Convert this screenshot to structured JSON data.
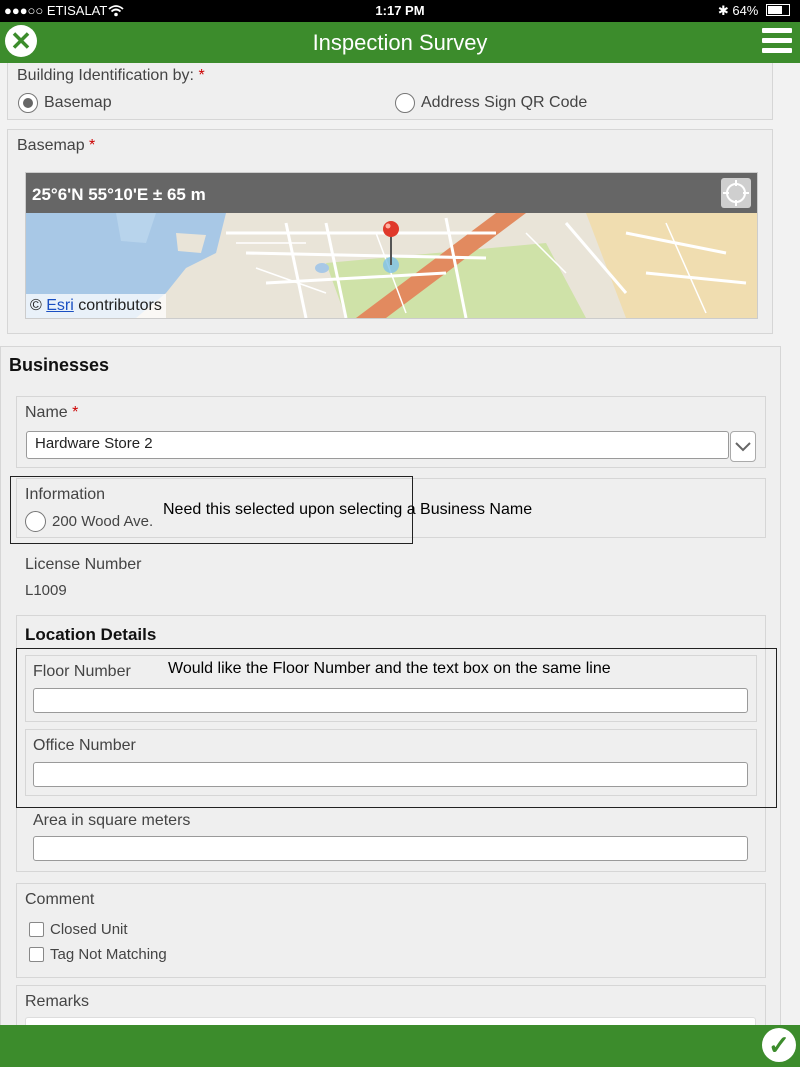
{
  "status_bar": {
    "carrier": "●●●○○ ETISALAT",
    "time": "1:17 PM",
    "battery": "64%",
    "battery_level": 0.64
  },
  "header": {
    "title": "Inspection Survey"
  },
  "building_identification": {
    "label": "Building Identification by:",
    "required": "*",
    "options": [
      {
        "label": "Basemap",
        "selected": true
      },
      {
        "label": "Address Sign QR Code",
        "selected": false
      }
    ]
  },
  "basemap": {
    "label": "Basemap",
    "required": "*",
    "coordinates": "25°6'N 55°10'E ± 65 m",
    "attribution_symbol": "©",
    "attribution_link": "Esri",
    "attribution_text": "contributors"
  },
  "businesses": {
    "title": "Businesses",
    "name": {
      "label": "Name",
      "required": "*",
      "value": "Hardware Store 2"
    },
    "information": {
      "label": "Information",
      "option": "200 Wood Ave."
    },
    "license_number": {
      "label": "License Number",
      "value": "L1009"
    },
    "location_details": {
      "title": "Location Details",
      "floor_number_label": "Floor Number",
      "office_number_label": "Office Number",
      "area_label": "Area in square meters"
    },
    "comment": {
      "label": "Comment",
      "options": [
        {
          "label": "Closed Unit"
        },
        {
          "label": "Tag Not Matching"
        }
      ]
    },
    "remarks": {
      "label": "Remarks"
    }
  },
  "annotations": {
    "information_note": "Need this selected upon selecting a Business Name",
    "location_note": "Would like the Floor Number and the text box on the same line"
  },
  "colors": {
    "header_green": "#3c8c2c",
    "required_red": "#cc0000"
  }
}
